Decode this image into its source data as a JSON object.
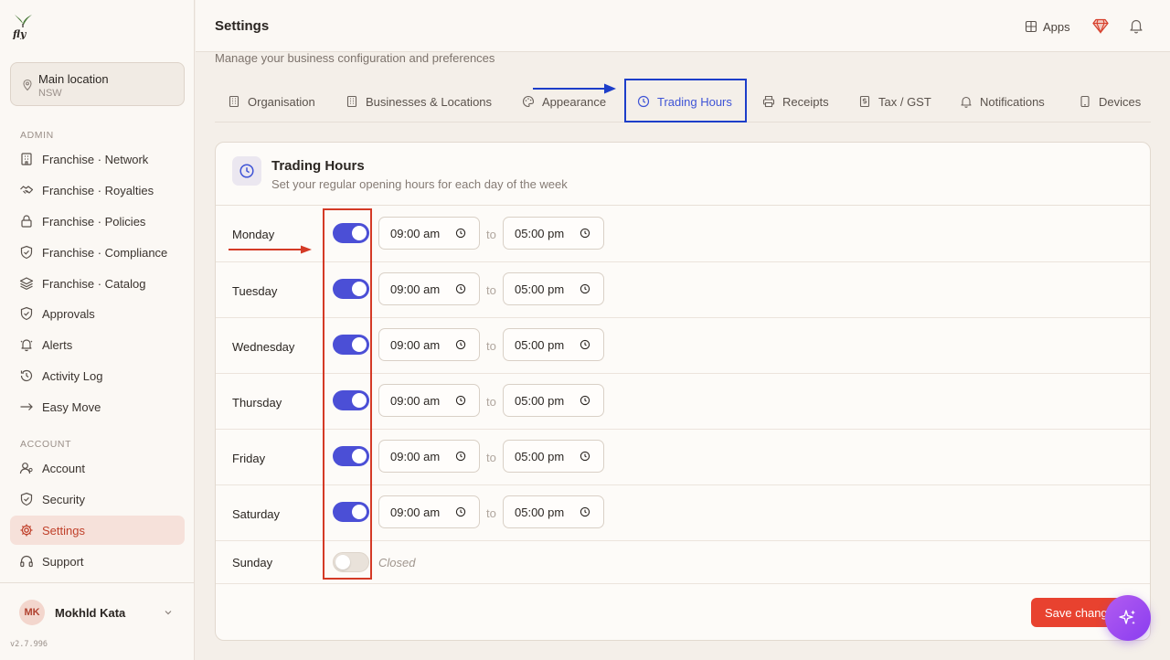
{
  "topbar": {
    "title": "Settings",
    "apps_label": "Apps",
    "subtitle": "Manage your business configuration and preferences"
  },
  "location": {
    "name": "Main location",
    "region": "NSW"
  },
  "sidebar": {
    "admin_label": "ADMIN",
    "account_label": "ACCOUNT",
    "admin_items": [
      {
        "label": "Franchise · Network",
        "icon": "building-icon"
      },
      {
        "label": "Franchise · Royalties",
        "icon": "handshake-icon"
      },
      {
        "label": "Franchise · Policies",
        "icon": "lock-icon"
      },
      {
        "label": "Franchise · Compliance",
        "icon": "shield-icon"
      },
      {
        "label": "Franchise · Catalog",
        "icon": "layers-icon"
      },
      {
        "label": "Approvals",
        "icon": "shield-check-icon"
      },
      {
        "label": "Alerts",
        "icon": "bell-icon"
      },
      {
        "label": "Activity Log",
        "icon": "history-icon"
      },
      {
        "label": "Easy Move",
        "icon": "arrow-right-icon"
      }
    ],
    "account_items": [
      {
        "label": "Account",
        "icon": "user-icon"
      },
      {
        "label": "Security",
        "icon": "shield-icon"
      },
      {
        "label": "Settings",
        "icon": "gear-icon",
        "active": true
      },
      {
        "label": "Support",
        "icon": "headset-icon"
      }
    ]
  },
  "user": {
    "initials": "MK",
    "name": "Mokhld Kata"
  },
  "version": "v2.7.996",
  "tabs": [
    {
      "label": "Organisation",
      "icon": "building-icon"
    },
    {
      "label": "Businesses & Locations",
      "icon": "building-icon"
    },
    {
      "label": "Appearance",
      "icon": "palette-icon"
    },
    {
      "label": "Trading Hours",
      "icon": "clock-icon",
      "active": true
    },
    {
      "label": "Receipts",
      "icon": "printer-icon"
    },
    {
      "label": "Tax / GST",
      "icon": "receipt-icon"
    },
    {
      "label": "Notifications",
      "icon": "bell-icon"
    },
    {
      "label": "Devices",
      "icon": "tablet-icon"
    }
  ],
  "trading_hours": {
    "title": "Trading Hours",
    "description": "Set your regular opening hours for each day of the week",
    "to_label": "to",
    "closed_label": "Closed",
    "days": [
      {
        "name": "Monday",
        "open": true,
        "from": "09:00 am",
        "to": "05:00 pm"
      },
      {
        "name": "Tuesday",
        "open": true,
        "from": "09:00 am",
        "to": "05:00 pm"
      },
      {
        "name": "Wednesday",
        "open": true,
        "from": "09:00 am",
        "to": "05:00 pm"
      },
      {
        "name": "Thursday",
        "open": true,
        "from": "09:00 am",
        "to": "05:00 pm"
      },
      {
        "name": "Friday",
        "open": true,
        "from": "09:00 am",
        "to": "05:00 pm"
      },
      {
        "name": "Saturday",
        "open": true,
        "from": "09:00 am",
        "to": "05:00 pm"
      },
      {
        "name": "Sunday",
        "open": false
      }
    ]
  },
  "save_label": "Save changes",
  "colors": {
    "accent": "#4b4fd6",
    "primary_action": "#e8422f",
    "annotation_blue": "#1d3ec9",
    "annotation_red": "#d43a26"
  }
}
